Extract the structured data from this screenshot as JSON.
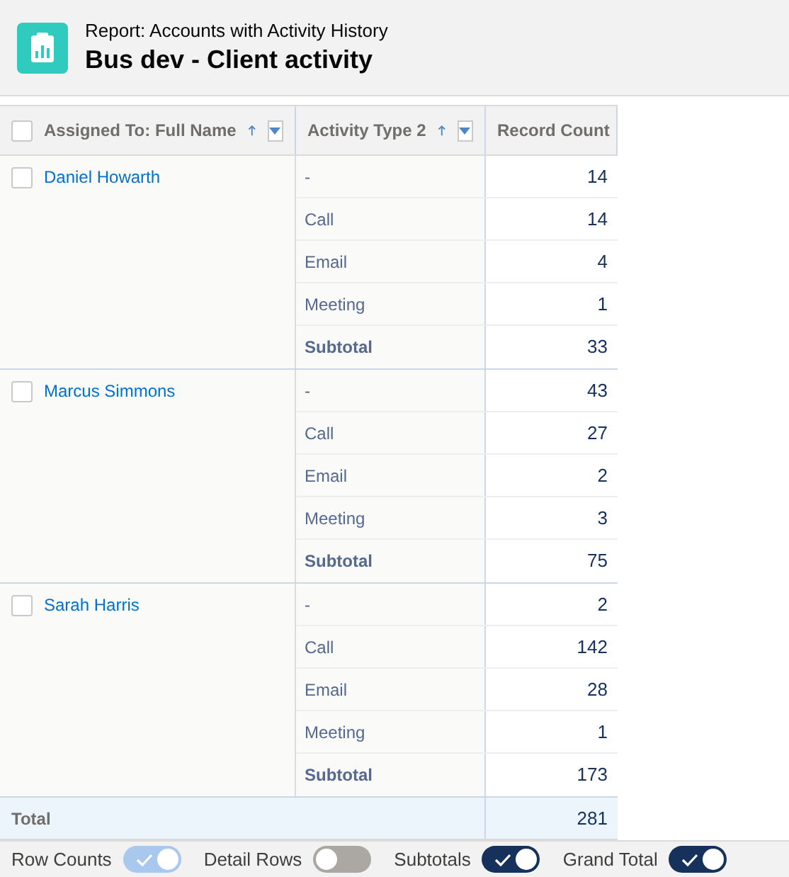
{
  "header": {
    "subtitle": "Report: Accounts with Activity History",
    "title": "Bus dev - Client activity"
  },
  "columns": [
    {
      "label": "Assigned To: Full Name",
      "sorted": true,
      "checked": false
    },
    {
      "label": "Activity Type 2",
      "sorted": true
    },
    {
      "label": "Record Count"
    }
  ],
  "groups": [
    {
      "name": "Daniel Howarth",
      "checked": false,
      "rows": [
        {
          "type": "-",
          "count": "14",
          "kind": "detail"
        },
        {
          "type": "Call",
          "count": "14",
          "kind": "detail"
        },
        {
          "type": "Email",
          "count": "4",
          "kind": "detail"
        },
        {
          "type": "Meeting",
          "count": "1",
          "kind": "detail"
        },
        {
          "type": "Subtotal",
          "count": "33",
          "kind": "subtotal"
        }
      ]
    },
    {
      "name": "Marcus Simmons",
      "checked": false,
      "rows": [
        {
          "type": "-",
          "count": "43",
          "kind": "detail"
        },
        {
          "type": "Call",
          "count": "27",
          "kind": "detail"
        },
        {
          "type": "Email",
          "count": "2",
          "kind": "detail"
        },
        {
          "type": "Meeting",
          "count": "3",
          "kind": "detail"
        },
        {
          "type": "Subtotal",
          "count": "75",
          "kind": "subtotal"
        }
      ]
    },
    {
      "name": "Sarah Harris",
      "checked": false,
      "rows": [
        {
          "type": "-",
          "count": "2",
          "kind": "detail"
        },
        {
          "type": "Call",
          "count": "142",
          "kind": "detail"
        },
        {
          "type": "Email",
          "count": "28",
          "kind": "detail"
        },
        {
          "type": "Meeting",
          "count": "1",
          "kind": "detail"
        },
        {
          "type": "Subtotal",
          "count": "173",
          "kind": "subtotal"
        }
      ]
    }
  ],
  "total": {
    "label": "Total",
    "count": "281"
  },
  "toggles": [
    {
      "label": "Row Counts",
      "on": true,
      "disabled": true
    },
    {
      "label": "Detail Rows",
      "on": false,
      "disabled": false
    },
    {
      "label": "Subtotals",
      "on": true,
      "disabled": false
    },
    {
      "label": "Grand Total",
      "on": true,
      "disabled": false
    }
  ]
}
